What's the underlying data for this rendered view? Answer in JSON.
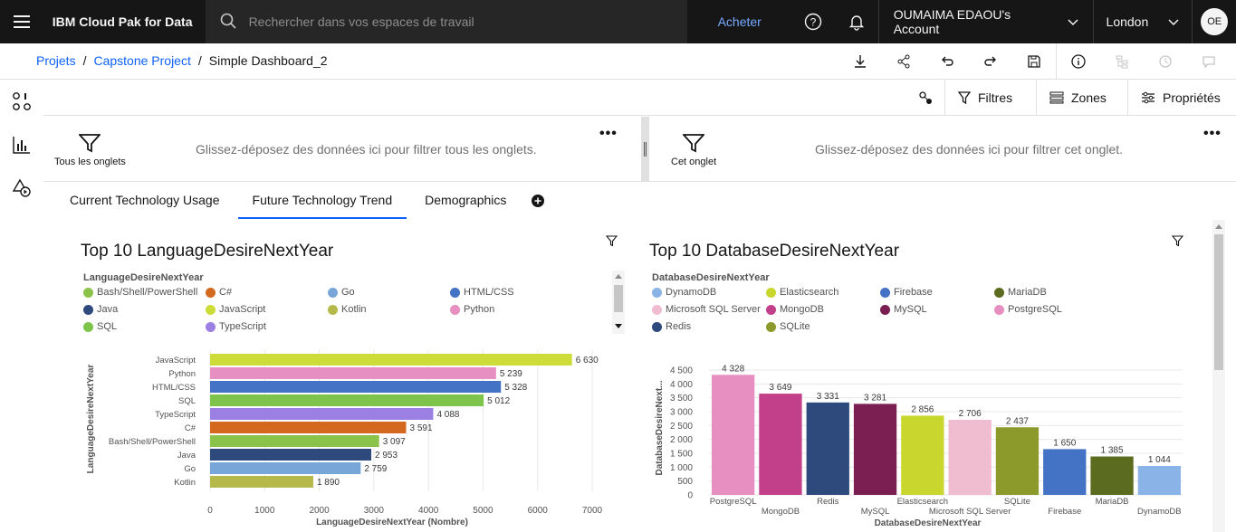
{
  "topbar": {
    "brand": "IBM Cloud Pak for Data",
    "search_placeholder": "Rechercher dans vos espaces de travail",
    "buy_label": "Acheter",
    "account_label": "OUMAIMA EDAOU's Account",
    "region_label": "London",
    "avatar_initials": "OE"
  },
  "breadcrumb": {
    "items": [
      "Projets",
      "Capstone Project"
    ],
    "current": "Simple Dashboard_2",
    "separator": "/"
  },
  "toolbar": {
    "filters_label": "Filtres",
    "zones_label": "Zones",
    "properties_label": "Propriétés"
  },
  "dropzones": {
    "all_tabs_label": "Tous les onglets",
    "all_tabs_text": "Glissez-déposez des données ici pour filtrer tous les onglets.",
    "this_tab_label": "Cet onglet",
    "this_tab_text": "Glissez-déposez des données ici pour filtrer cet onglet.",
    "more": "•••"
  },
  "tabs": [
    "Current Technology Usage",
    "Future Technology Trend",
    "Demographics"
  ],
  "active_tab": 1,
  "colors": {
    "accent": "#0f62fe",
    "topbar_bg": "#161616"
  },
  "panels": {
    "language": {
      "title": "Top 10 LanguageDesireNextYear",
      "legend_title": "LanguageDesireNextYear",
      "legend": [
        {
          "label": "Bash/Shell/PowerShell",
          "color": "#8bc34a"
        },
        {
          "label": "C#",
          "color": "#d2691e"
        },
        {
          "label": "Go",
          "color": "#79a6d9"
        },
        {
          "label": "HTML/CSS",
          "color": "#4472c4"
        },
        {
          "label": "Java",
          "color": "#2e4a7d"
        },
        {
          "label": "JavaScript",
          "color": "#cddc39"
        },
        {
          "label": "Kotlin",
          "color": "#b5b949"
        },
        {
          "label": "Python",
          "color": "#e68fc0"
        },
        {
          "label": "SQL",
          "color": "#7ec34a"
        },
        {
          "label": "TypeScript",
          "color": "#9c7fe3"
        }
      ]
    },
    "database": {
      "title": "Top 10 DatabaseDesireNextYear",
      "legend_title": "DatabaseDesireNextYear",
      "legend": [
        {
          "label": "DynamoDB",
          "color": "#8ab4e8"
        },
        {
          "label": "Elasticsearch",
          "color": "#c8d62d"
        },
        {
          "label": "Firebase",
          "color": "#4472c4"
        },
        {
          "label": "MariaDB",
          "color": "#5b6b1f"
        },
        {
          "label": "Microsoft SQL Server",
          "color": "#f0bcd0"
        },
        {
          "label": "MongoDB",
          "color": "#c2408a"
        },
        {
          "label": "MySQL",
          "color": "#7b1f52"
        },
        {
          "label": "PostgreSQL",
          "color": "#e68fc0"
        },
        {
          "label": "Redis",
          "color": "#2e4a7d"
        },
        {
          "label": "SQLite",
          "color": "#8c9a2b"
        }
      ]
    }
  },
  "chart_data": [
    {
      "type": "bar",
      "orientation": "horizontal",
      "title": "Top 10 LanguageDesireNextYear",
      "xlabel": "LanguageDesireNextYear (Nombre)",
      "ylabel": "LanguageDesireNextYear",
      "categories": [
        "JavaScript",
        "Python",
        "HTML/CSS",
        "SQL",
        "TypeScript",
        "C#",
        "Bash/Shell/PowerShell",
        "Java",
        "Go",
        "Kotlin"
      ],
      "values": [
        6630,
        5239,
        5328,
        5012,
        4088,
        3591,
        3097,
        2953,
        2759,
        1890
      ],
      "value_labels": [
        "6 630",
        "5 239",
        "5 328",
        "5 012",
        "4 088",
        "3 591",
        "3 097",
        "2 953",
        "2 759",
        "1 890"
      ],
      "colors": [
        "#cddc39",
        "#e68fc0",
        "#4472c4",
        "#7ec34a",
        "#9c7fe3",
        "#d2691e",
        "#8bc34a",
        "#2e4a7d",
        "#79a6d9",
        "#b5b949"
      ],
      "xlim": [
        0,
        7000
      ],
      "xticks": [
        "0",
        "1000",
        "2000",
        "3000",
        "4000",
        "5000",
        "6000",
        "7000"
      ],
      "grid": true
    },
    {
      "type": "bar",
      "orientation": "vertical",
      "title": "Top 10 DatabaseDesireNextYear",
      "xlabel": "DatabaseDesireNextYear",
      "ylabel": "DatabaseDesireNext...",
      "categories": [
        "PostgreSQL",
        "MongoDB",
        "Redis",
        "MySQL",
        "Elasticsearch",
        "Microsoft SQL Server",
        "SQLite",
        "Firebase",
        "MariaDB",
        "DynamoDB"
      ],
      "values": [
        4328,
        3649,
        3331,
        3281,
        2856,
        2706,
        2437,
        1650,
        1385,
        1044
      ],
      "value_labels": [
        "4 328",
        "3 649",
        "3 331",
        "3 281",
        "2 856",
        "2 706",
        "2 437",
        "1 650",
        "1 385",
        "1 044"
      ],
      "colors": [
        "#e68fc0",
        "#c2408a",
        "#2e4a7d",
        "#7b1f52",
        "#c8d62d",
        "#f0bcd0",
        "#8c9a2b",
        "#4472c4",
        "#5b6b1f",
        "#8ab4e8"
      ],
      "ylim": [
        0,
        4500
      ],
      "yticks": [
        "0",
        "500",
        "1 000",
        "1 500",
        "2 000",
        "2 500",
        "3 000",
        "3 500",
        "4 000",
        "4 500"
      ],
      "grid": true
    }
  ]
}
